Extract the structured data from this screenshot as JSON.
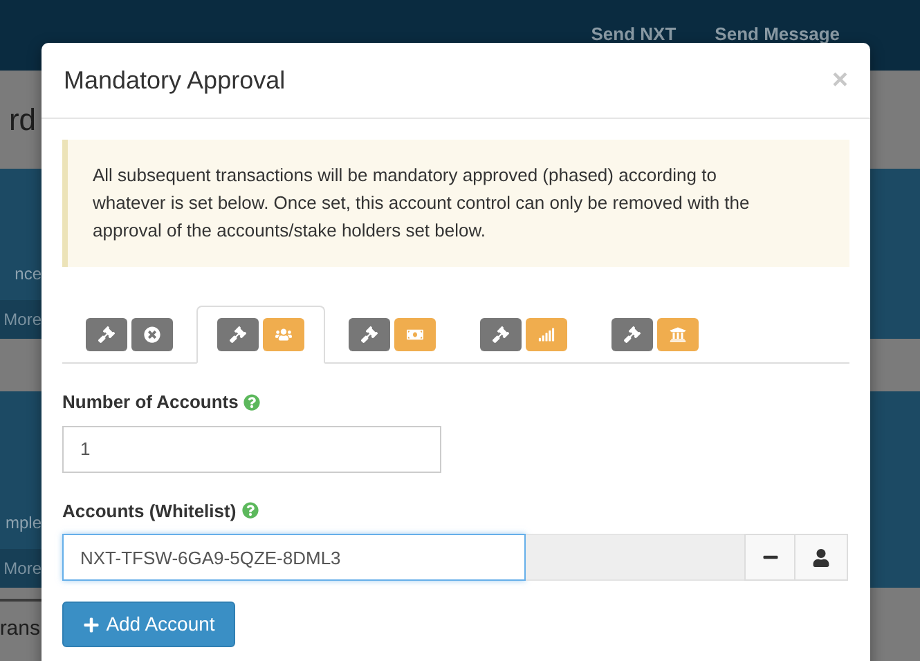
{
  "background": {
    "nav_links": [
      "Send NXT",
      "Send Message"
    ],
    "page_title": "rd",
    "cards": [
      {
        "caption": "nce",
        "link": "More"
      },
      {
        "caption": "mple",
        "link": "More"
      }
    ],
    "section_title": "rans"
  },
  "modal": {
    "title": "Mandatory Approval",
    "close": "×",
    "alert": "All subsequent transactions will be mandatory approved (phased) according to whatever is set below. Once set, this account control can only be removed with the approval of the accounts/stake holders set below.",
    "tabs": [
      {
        "kind": "none",
        "color": "#777777",
        "selected": false
      },
      {
        "kind": "accounts",
        "color": "#f0ad4e",
        "selected": true
      },
      {
        "kind": "balance",
        "color": "#f0ad4e",
        "selected": false
      },
      {
        "kind": "asset",
        "color": "#f0ad4e",
        "selected": false
      },
      {
        "kind": "currency",
        "color": "#f0ad4e",
        "selected": false
      }
    ],
    "number_of_accounts": {
      "label": "Number of Accounts",
      "value": "1"
    },
    "whitelist": {
      "label": "Accounts (Whitelist)",
      "value": "NXT-TFSW-6GA9-5QZE-8DML3",
      "focused": true
    },
    "add_button": "Add Account"
  }
}
